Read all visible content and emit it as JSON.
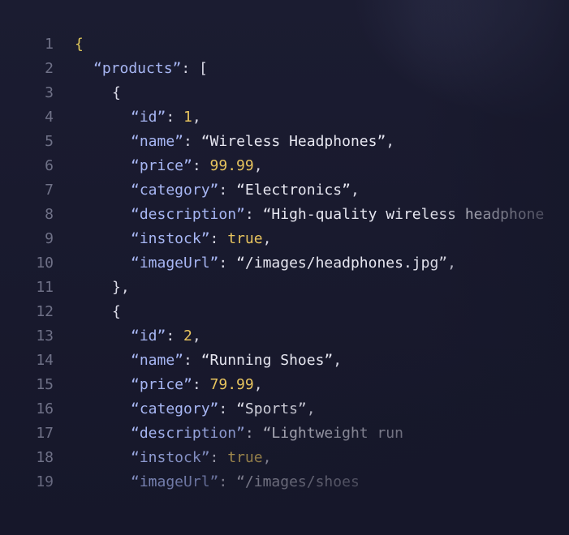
{
  "editor": {
    "lines": [
      {
        "num": "1",
        "indent": 0,
        "tokens": [
          {
            "t": "{",
            "c": "brace"
          }
        ]
      },
      {
        "num": "2",
        "indent": 1,
        "tokens": [
          {
            "t": "“products”",
            "c": "key"
          },
          {
            "t": ": [",
            "c": "punct"
          }
        ]
      },
      {
        "num": "3",
        "indent": 2,
        "tokens": [
          {
            "t": "{",
            "c": "punct"
          }
        ]
      },
      {
        "num": "4",
        "indent": 3,
        "tokens": [
          {
            "t": "“id”",
            "c": "key"
          },
          {
            "t": ": ",
            "c": "punct"
          },
          {
            "t": "1",
            "c": "num"
          },
          {
            "t": ",",
            "c": "punct"
          }
        ]
      },
      {
        "num": "5",
        "indent": 3,
        "tokens": [
          {
            "t": "“name”",
            "c": "key"
          },
          {
            "t": ": ",
            "c": "punct"
          },
          {
            "t": "“Wireless Headphones”",
            "c": "str"
          },
          {
            "t": ",",
            "c": "punct"
          }
        ]
      },
      {
        "num": "6",
        "indent": 3,
        "tokens": [
          {
            "t": "“price”",
            "c": "key"
          },
          {
            "t": ": ",
            "c": "punct"
          },
          {
            "t": "99.99",
            "c": "num"
          },
          {
            "t": ",",
            "c": "punct"
          }
        ]
      },
      {
        "num": "7",
        "indent": 3,
        "tokens": [
          {
            "t": "“category”",
            "c": "key"
          },
          {
            "t": ": ",
            "c": "punct"
          },
          {
            "t": "“Electronics”",
            "c": "str"
          },
          {
            "t": ",",
            "c": "punct"
          }
        ]
      },
      {
        "num": "8",
        "indent": 3,
        "tokens": [
          {
            "t": "“description”",
            "c": "key"
          },
          {
            "t": ": ",
            "c": "punct"
          },
          {
            "t": "“High-quality wireless headphone",
            "c": "str"
          }
        ]
      },
      {
        "num": "9",
        "indent": 3,
        "tokens": [
          {
            "t": "“instock”",
            "c": "key"
          },
          {
            "t": ": ",
            "c": "punct"
          },
          {
            "t": "true",
            "c": "bool"
          },
          {
            "t": ",",
            "c": "punct"
          }
        ]
      },
      {
        "num": "10",
        "indent": 3,
        "tokens": [
          {
            "t": "“imageUrl”",
            "c": "key"
          },
          {
            "t": ": ",
            "c": "punct"
          },
          {
            "t": "“/images/headphones.jpg”",
            "c": "str"
          },
          {
            "t": ",",
            "c": "punct"
          }
        ]
      },
      {
        "num": "11",
        "indent": 2,
        "tokens": [
          {
            "t": "},",
            "c": "punct"
          }
        ]
      },
      {
        "num": "12",
        "indent": 2,
        "tokens": [
          {
            "t": "{",
            "c": "punct"
          }
        ]
      },
      {
        "num": "13",
        "indent": 3,
        "tokens": [
          {
            "t": "“id”",
            "c": "key"
          },
          {
            "t": ": ",
            "c": "punct"
          },
          {
            "t": "2",
            "c": "num"
          },
          {
            "t": ",",
            "c": "punct"
          }
        ]
      },
      {
        "num": "14",
        "indent": 3,
        "tokens": [
          {
            "t": "“name”",
            "c": "key"
          },
          {
            "t": ": ",
            "c": "punct"
          },
          {
            "t": "“Running Shoes”",
            "c": "str"
          },
          {
            "t": ",",
            "c": "punct"
          }
        ]
      },
      {
        "num": "15",
        "indent": 3,
        "tokens": [
          {
            "t": "“price”",
            "c": "key"
          },
          {
            "t": ": ",
            "c": "punct"
          },
          {
            "t": "79.99",
            "c": "num"
          },
          {
            "t": ",",
            "c": "punct"
          }
        ]
      },
      {
        "num": "16",
        "indent": 3,
        "tokens": [
          {
            "t": "“category”",
            "c": "key"
          },
          {
            "t": ": ",
            "c": "punct"
          },
          {
            "t": "“Sports”",
            "c": "str"
          },
          {
            "t": ",",
            "c": "punct"
          }
        ]
      },
      {
        "num": "17",
        "indent": 3,
        "tokens": [
          {
            "t": "“description”",
            "c": "key"
          },
          {
            "t": ": ",
            "c": "punct"
          },
          {
            "t": "“Lightweight run",
            "c": "str"
          }
        ]
      },
      {
        "num": "18",
        "indent": 3,
        "tokens": [
          {
            "t": "“instock”",
            "c": "key"
          },
          {
            "t": ": ",
            "c": "punct"
          },
          {
            "t": "true",
            "c": "bool"
          },
          {
            "t": ",",
            "c": "punct"
          }
        ]
      },
      {
        "num": "19",
        "indent": 3,
        "tokens": [
          {
            "t": "“imageUrl”",
            "c": "key"
          },
          {
            "t": ": ",
            "c": "punct"
          },
          {
            "t": "“/images/shoes",
            "c": "str"
          }
        ]
      }
    ]
  },
  "colors": {
    "background": "#16172a",
    "line_number": "#6f7187",
    "key": "#a7b6f3",
    "string": "#e6e6f0",
    "number": "#e8c45e",
    "brace": "#e0c95a"
  }
}
